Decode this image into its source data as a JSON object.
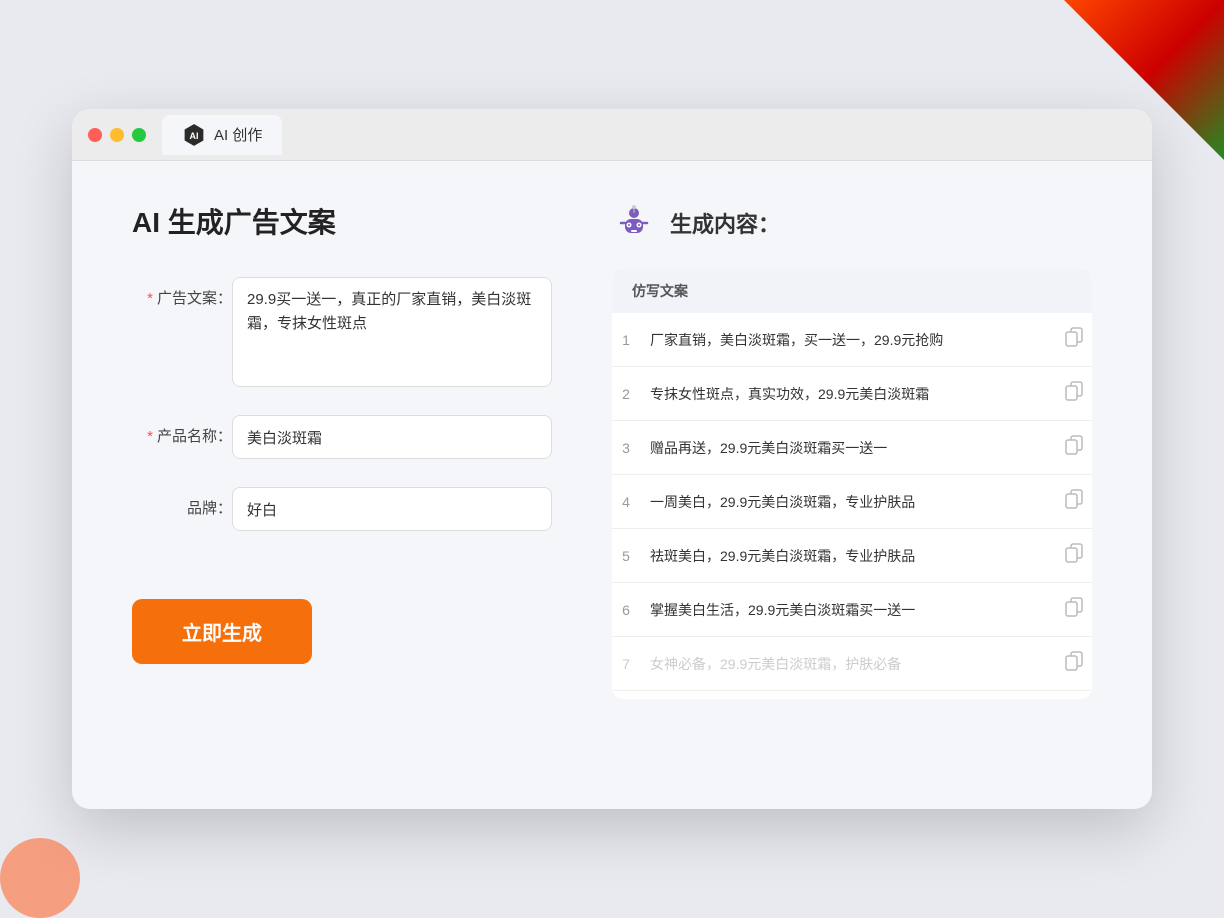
{
  "window": {
    "tab_label": "AI 创作"
  },
  "page": {
    "title": "AI 生成广告文案"
  },
  "form": {
    "ad_copy_label": "广告文案：",
    "ad_copy_required": "*",
    "ad_copy_value": "29.9买一送一，真正的厂家直销，美白淡斑霜，专抹女性斑点",
    "product_name_label": "产品名称：",
    "product_name_required": "*",
    "product_name_value": "美白淡斑霜",
    "brand_label": "品牌：",
    "brand_value": "好白",
    "generate_button": "立即生成"
  },
  "result": {
    "title": "生成内容：",
    "column_header": "仿写文案",
    "items": [
      {
        "num": "1",
        "text": "厂家直销，美白淡斑霜，买一送一，29.9元抢购",
        "dimmed": false
      },
      {
        "num": "2",
        "text": "专抹女性斑点，真实功效，29.9元美白淡斑霜",
        "dimmed": false
      },
      {
        "num": "3",
        "text": "赠品再送，29.9元美白淡斑霜买一送一",
        "dimmed": false
      },
      {
        "num": "4",
        "text": "一周美白，29.9元美白淡斑霜，专业护肤品",
        "dimmed": false
      },
      {
        "num": "5",
        "text": "祛斑美白，29.9元美白淡斑霜，专业护肤品",
        "dimmed": false
      },
      {
        "num": "6",
        "text": "掌握美白生活，29.9元美白淡斑霜买一送一",
        "dimmed": false
      },
      {
        "num": "7",
        "text": "女神必备，29.9元美白淡斑霜，护肤必备",
        "dimmed": true
      }
    ]
  },
  "colors": {
    "orange": "#f5700a",
    "accent_blue": "#4a90d9",
    "required_red": "#ff4d4f"
  }
}
